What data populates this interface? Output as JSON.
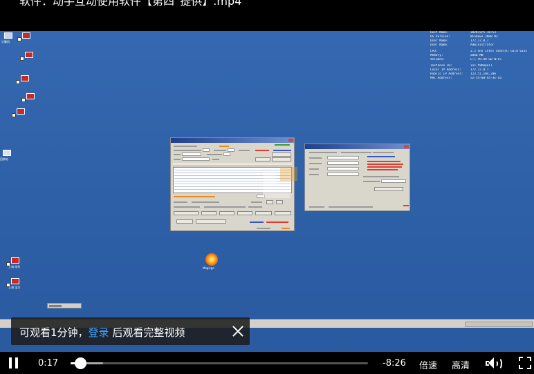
{
  "video_title": "软件：动手互动使用软件【第四“提供】.mp4",
  "sysinfo": [
    {
      "k": "Host Name:",
      "v": "2020/8/5 10:53"
    },
    {
      "k": "OS Version:",
      "v": "Windows 2008 R2"
    },
    {
      "k": "User Name:",
      "v": "172_17_0_7"
    },
    {
      "k": "User Name:",
      "v": "Administrator"
    },
    {
      "k": "",
      "v": ""
    },
    {
      "k": "CPU:",
      "v": "2.5 Ghz Intel Xeon(R) Gold 61xx"
    },
    {
      "k": "Memory:",
      "v": "2048 MB"
    },
    {
      "k": "Volumes:",
      "v": "C:\\ 49.90 GB NTFS"
    },
    {
      "k": "",
      "v": ""
    },
    {
      "k": "Instance ID:",
      "v": "ins-f8bmpall"
    },
    {
      "k": "Local IP Address:",
      "v": "172.17.0.7"
    },
    {
      "k": "Public IP Address:",
      "v": "123.51.104.206"
    },
    {
      "k": "MAC Address:",
      "v": "52-54-00-45-3E-Cb"
    }
  ],
  "desktop_icons": [
    {
      "label": "计算机"
    },
    {
      "label": ""
    },
    {
      "label": ""
    },
    {
      "label": ""
    },
    {
      "label": ""
    },
    {
      "label": ""
    },
    {
      "label": "回收站"
    },
    {
      "label": "上海 动作"
    },
    {
      "label": "上海 宝贝"
    }
  ],
  "app_icon_label": "Magicgo",
  "login_toast": {
    "prefix": "可观看1分钟，",
    "link": "登录",
    "suffix": " 后观看完整视频"
  },
  "controls": {
    "current_time": "0:17",
    "remaining_time": "-8:26",
    "speed_label": "倍速",
    "quality_label": "高清",
    "progress": 0.033,
    "buffered": 0.11
  },
  "colors": {
    "desktop_bg": "#2f62a8",
    "link_blue": "#3ea0ff"
  }
}
